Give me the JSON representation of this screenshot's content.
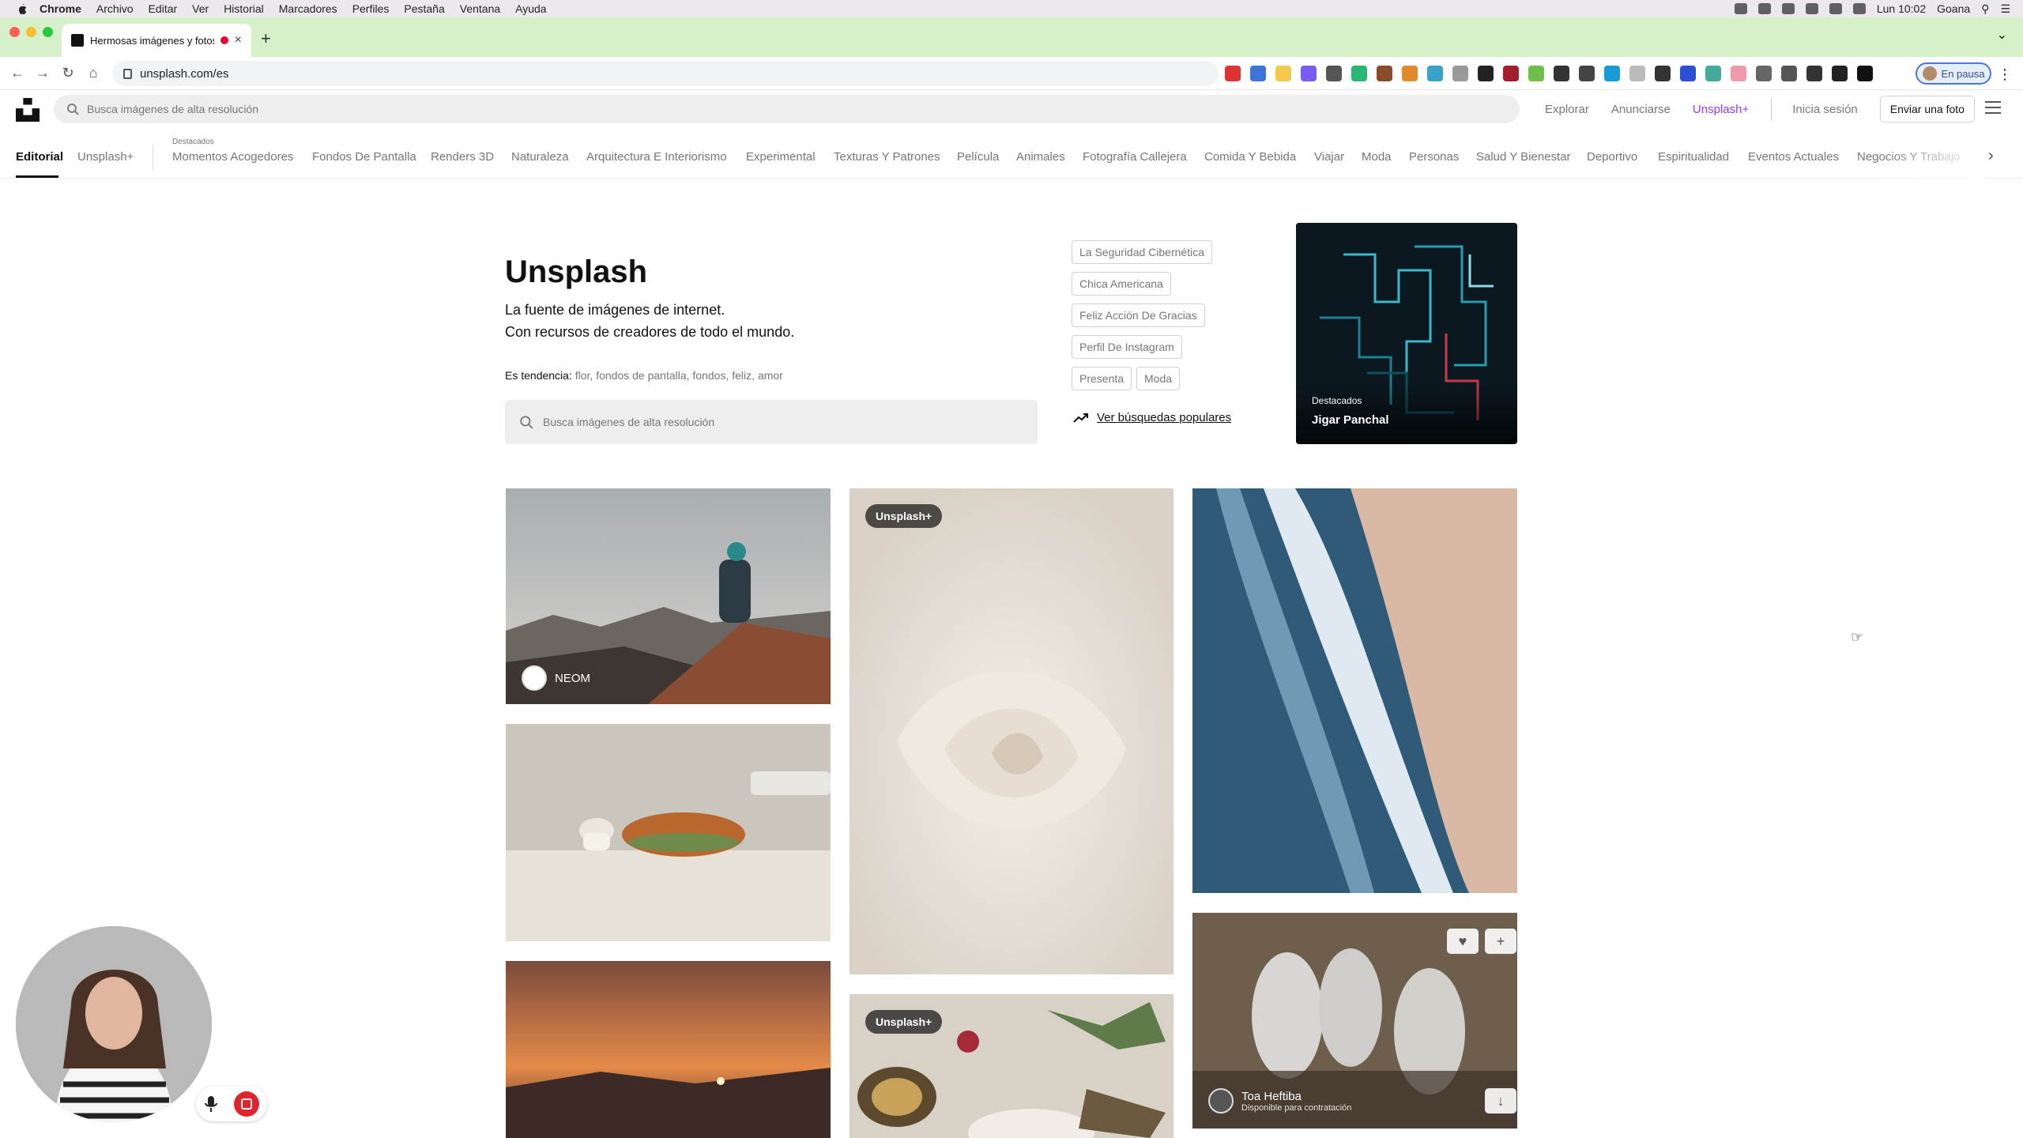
{
  "os_menu": {
    "app": "Chrome",
    "items": [
      "Archivo",
      "Editar",
      "Ver",
      "Historial",
      "Marcadores",
      "Perfiles",
      "Pestaña",
      "Ventana",
      "Ayuda"
    ],
    "clock": "Lun 10:02",
    "user": "Goana"
  },
  "browser": {
    "tab_title": "Hermosas imágenes y fotos",
    "url": "unsplash.com/es",
    "profile_status": "En pausa"
  },
  "header": {
    "search_placeholder": "Busca imágenes de alta resolución",
    "nav": {
      "explorar": "Explorar",
      "anunciarse": "Anunciarse",
      "unsplash_plus": "Unsplash+",
      "login": "Inicia sesión",
      "submit": "Enviar una foto"
    }
  },
  "categories": {
    "destacados_label": "Destacados",
    "items": [
      "Editorial",
      "Unsplash+",
      "Momentos Acogedores",
      "Fondos De Pantalla",
      "Renders 3D",
      "Naturaleza",
      "Arquitectura E Interiorismo",
      "Experimental",
      "Texturas Y Patrones",
      "Película",
      "Animales",
      "Fotografía Callejera",
      "Comida Y Bebida",
      "Viajar",
      "Moda",
      "Personas",
      "Salud Y Bienestar",
      "Deportivo",
      "Espiritualidad",
      "Eventos Actuales",
      "Negocios Y Trabajo"
    ]
  },
  "hero": {
    "title": "Unsplash",
    "subtitle_line1": "La fuente de imágenes de internet.",
    "subtitle_line2": "Con recursos de creadores de todo el mundo.",
    "trending_label": "Es tendencia:",
    "trending": [
      "flor",
      "fondos de pantalla",
      "fondos",
      "feliz",
      "amor"
    ],
    "search_placeholder": "Busca imágenes de alta resolución"
  },
  "chips": [
    "La Seguridad Cibernética",
    "Chica Americana",
    "Feliz Acción De Gracias",
    "Perfil De Instagram",
    "Presenta",
    "Moda"
  ],
  "popular_link": "Ver búsquedas populares",
  "featured": {
    "label": "Destacados",
    "author": "Jigar Panchal"
  },
  "photos": {
    "neom_author": "NEOM",
    "badge_plus": "Unsplash+",
    "toa_author": "Toa Heftiba",
    "toa_status": "Disponible para contratación"
  },
  "colors": {
    "accent_plus": "#8c3df5",
    "tab_strip": "#d6f0c9",
    "record": "#e0242b"
  }
}
